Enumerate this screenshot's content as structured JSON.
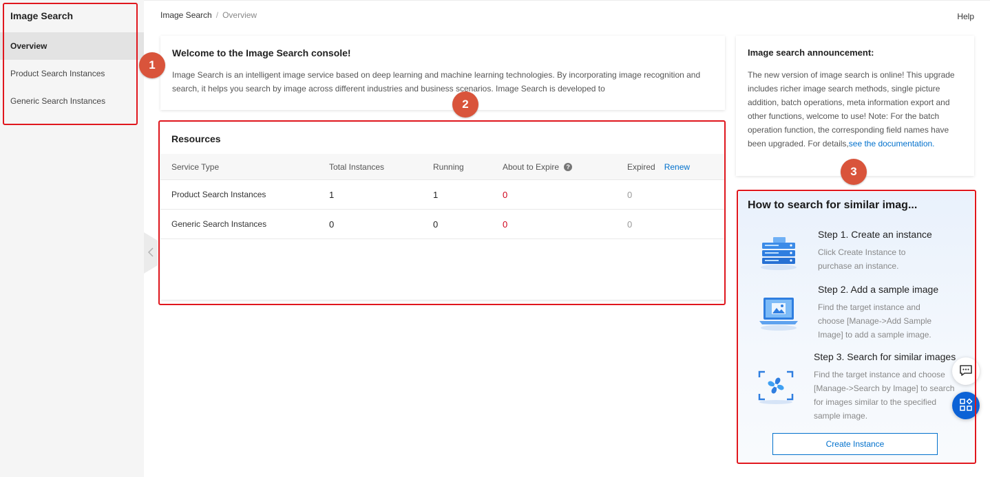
{
  "sidebar": {
    "title": "Image Search",
    "items": [
      {
        "label": "Overview"
      },
      {
        "label": "Product Search Instances"
      },
      {
        "label": "Generic Search Instances"
      }
    ]
  },
  "breadcrumb": {
    "root": "Image Search",
    "separator": "/",
    "current": "Overview"
  },
  "header": {
    "help": "Help"
  },
  "welcome": {
    "title": "Welcome to the Image Search console!",
    "body": "Image Search is an intelligent image service based on deep learning and machine learning technologies. By incorporating image recognition and search, it helps you search by image across different industries and business scenarios. Image Search is developed to"
  },
  "resources": {
    "title": "Resources",
    "columns": {
      "service_type": "Service Type",
      "total": "Total Instances",
      "running": "Running",
      "about_to_expire": "About to Expire",
      "expired": "Expired",
      "renew": "Renew"
    },
    "rows": [
      {
        "service_type": "Product Search Instances",
        "total": "1",
        "running": "1",
        "about_to_expire": "0",
        "expired": "0"
      },
      {
        "service_type": "Generic Search Instances",
        "total": "0",
        "running": "0",
        "about_to_expire": "0",
        "expired": "0"
      }
    ]
  },
  "announcement": {
    "title": "Image search announcement:",
    "body": "The new version of image search is online! This upgrade includes richer image search methods, single picture addition, batch operations, meta information export and other functions, welcome to use! Note: For the batch operation function, the corresponding field names have been upgraded. For details,",
    "link": "see the documentation."
  },
  "howto": {
    "title": "How to search for similar imag...",
    "steps": [
      {
        "title": "Step 1. Create an instance",
        "desc": "Click Create Instance to purchase an instance."
      },
      {
        "title": "Step 2. Add a sample image",
        "desc": "Find the target instance and choose [Manage->Add Sample Image] to add a sample image."
      },
      {
        "title": "Step 3. Search for similar images",
        "desc": "Find the target instance and choose [Manage->Search by Image] to search for images similar to the specified sample image."
      }
    ],
    "button": "Create Instance"
  },
  "annotations": {
    "badges": [
      "1",
      "2",
      "3"
    ]
  },
  "colors": {
    "accent": "#0070cc",
    "alert": "#d0021b",
    "annotation": "#e0161d",
    "badge": "#d9543b"
  }
}
